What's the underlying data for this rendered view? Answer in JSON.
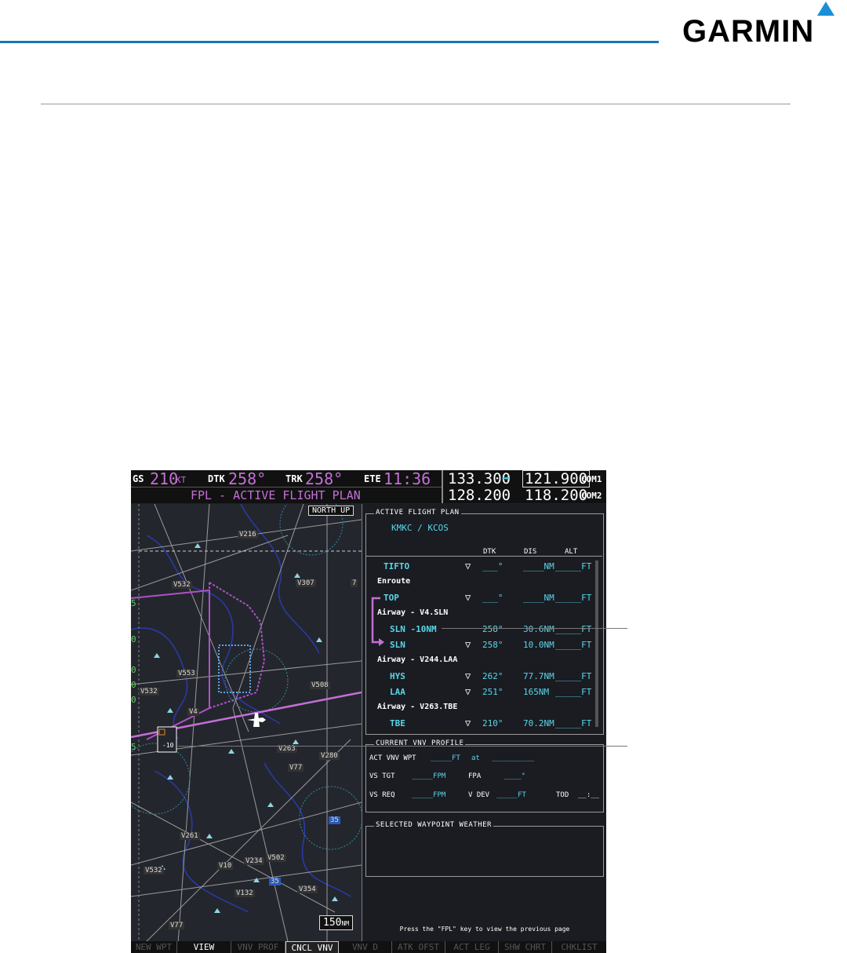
{
  "brand": "GARMIN",
  "header": {
    "gs_label": "GS",
    "gs_value": "210",
    "gs_unit": "KT",
    "dtk_label": "DTK",
    "dtk_value": "258°",
    "trk_label": "TRK",
    "trk_value": "258°",
    "ete_label": "ETE",
    "ete_value": "11:36",
    "page_title": "FPL - ACTIVE FLIGHT PLAN"
  },
  "radios": {
    "com1_standby": "133.300",
    "swap_icon": "↔",
    "com1_active": "121.900",
    "com1_label": "COM1",
    "com2_standby": "128.200",
    "com2_active": "118.200",
    "com2_label": "COM2"
  },
  "map": {
    "orientation": "NORTH UP",
    "range": "150",
    "range_unit": "NM",
    "labels": [
      "V216",
      "V532",
      "V307",
      "V553",
      "V508",
      "V532",
      "V280",
      "V77",
      "V261",
      "V502",
      "V234",
      "V10",
      "V532",
      "V132",
      "V354",
      "V77",
      "35",
      "35",
      "V4",
      "V263",
      "7"
    ],
    "side_ticks": [
      "5",
      "0",
      "0",
      "0",
      "0",
      "5"
    ]
  },
  "flight_plan": {
    "box_title": "ACTIVE FLIGHT PLAN",
    "route": "KMKC / KCOS",
    "col_dtk": "DTK",
    "col_dis": "DIS",
    "col_alt": "ALT",
    "rows": [
      {
        "name": "TIFTO",
        "dtk": "___°",
        "dis": "____NM",
        "alt": "_____FT"
      },
      {
        "name": "Enroute"
      },
      {
        "name": "TOP",
        "dtk": "___°",
        "dis": "____NM",
        "alt": "_____FT"
      },
      {
        "name": "Airway - V4.SLN"
      },
      {
        "name": "SLN -10NM",
        "dtk": "258°",
        "dis": "30.6NM",
        "alt": "_____FT"
      },
      {
        "name": "SLN",
        "dtk": "258°",
        "dis": "10.0NM",
        "alt": "_____FT"
      },
      {
        "name": "Airway - V244.LAA"
      },
      {
        "name": "HYS",
        "dtk": "262°",
        "dis": "77.7NM",
        "alt": "_____FT"
      },
      {
        "name": "LAA",
        "dtk": "251°",
        "dis": "165NM",
        "alt": "_____FT"
      },
      {
        "name": "Airway - V263.TBE"
      },
      {
        "name": "TBE",
        "dtk": "210°",
        "dis": "70.2NM",
        "alt": "_____FT"
      }
    ]
  },
  "vnv": {
    "box_title": "CURRENT VNV PROFILE",
    "act_wpt_label": "ACT VNV WPT",
    "act_wpt_value": "_____FT",
    "at": "at",
    "at_value": "__________",
    "vs_tgt_label": "VS TGT",
    "vs_tgt_value": "_____FPM",
    "fpa_label": "FPA",
    "fpa_value": "____°",
    "vs_req_label": "VS REQ",
    "vs_req_value": "_____FPM",
    "vdev_label": "V DEV",
    "vdev_value": "_____FT",
    "tod_label": "TOD",
    "tod_value": "__:__"
  },
  "weather": {
    "box_title": "SELECTED WAYPOINT WEATHER"
  },
  "footer_msg": "Press the \"FPL\" key to view the previous page",
  "softkeys": [
    "NEW WPT",
    "VIEW",
    "VNV PROF",
    "CNCL VNV",
    "VNV D",
    "ATK OFST",
    "ACT LEG",
    "SHW CHRT",
    "CHKLIST"
  ],
  "map_marker": "-10"
}
